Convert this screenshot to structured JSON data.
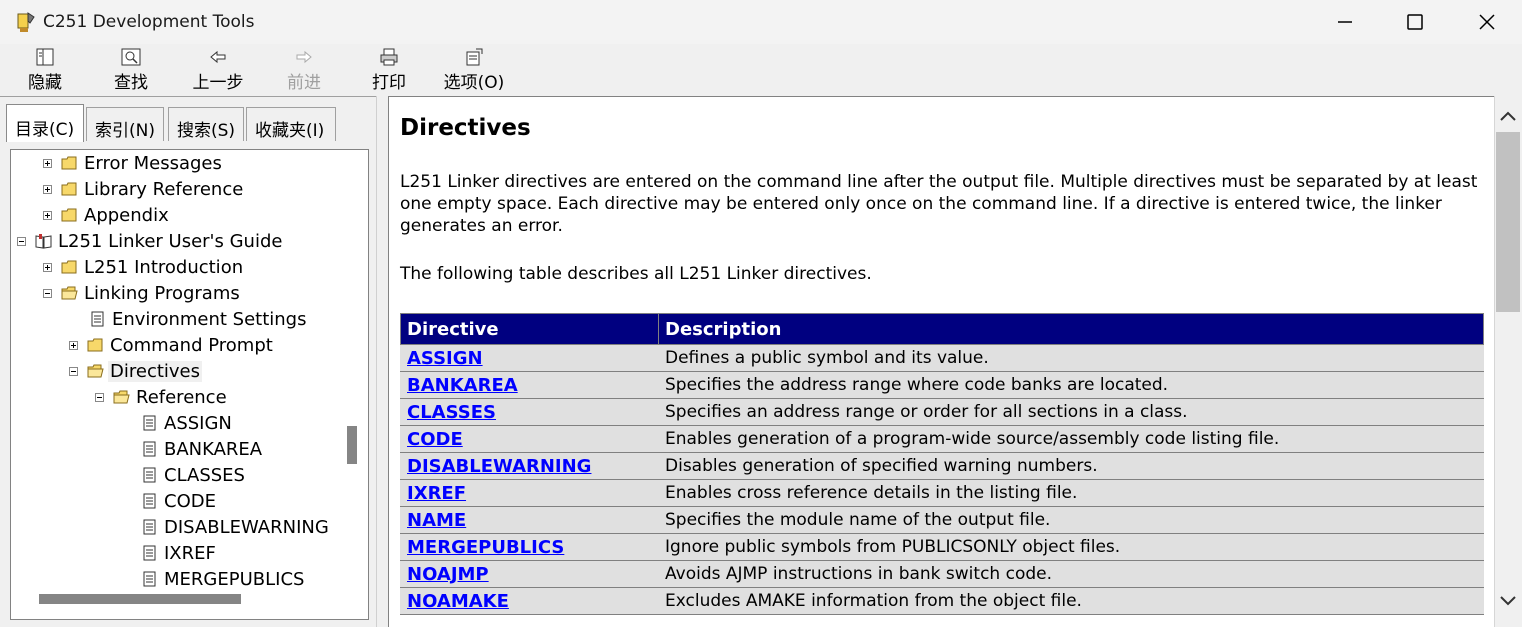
{
  "window": {
    "title": "C251 Development Tools"
  },
  "toolbar": {
    "buttons": [
      {
        "label": "隐藏",
        "icon": "hide-icon",
        "enabled": true
      },
      {
        "label": "查找",
        "icon": "find-icon",
        "enabled": true
      },
      {
        "label": "上一步",
        "icon": "back-icon",
        "enabled": true
      },
      {
        "label": "前进",
        "icon": "forward-icon",
        "enabled": false
      },
      {
        "label": "打印",
        "icon": "print-icon",
        "enabled": true
      },
      {
        "label": "选项(O)",
        "icon": "options-icon",
        "enabled": true
      }
    ]
  },
  "nav_tabs": [
    {
      "label": "目录(C)",
      "active": true
    },
    {
      "label": "索引(N)",
      "active": false
    },
    {
      "label": "搜索(S)",
      "active": false
    },
    {
      "label": "收藏夹(I)",
      "active": false
    }
  ],
  "tree": {
    "items": [
      {
        "label": "Error Messages",
        "type": "folder",
        "expander": "plus",
        "level": 1
      },
      {
        "label": "Library Reference",
        "type": "folder",
        "expander": "plus",
        "level": 1
      },
      {
        "label": "Appendix",
        "type": "folder",
        "expander": "plus",
        "level": 1
      },
      {
        "label": "L251 Linker User's Guide",
        "type": "book",
        "expander": "minus",
        "level": 0
      },
      {
        "label": "L251 Introduction",
        "type": "folder",
        "expander": "plus",
        "level": 1
      },
      {
        "label": "Linking Programs",
        "type": "folder-open",
        "expander": "minus",
        "level": 1
      },
      {
        "label": "Environment Settings",
        "type": "page",
        "expander": "none",
        "level": 2
      },
      {
        "label": "Command Prompt",
        "type": "folder",
        "expander": "plus",
        "level": 2
      },
      {
        "label": "Directives",
        "type": "folder-open",
        "expander": "minus",
        "level": 2,
        "selected": true
      },
      {
        "label": "Reference",
        "type": "folder-open",
        "expander": "minus",
        "level": 3
      },
      {
        "label": "ASSIGN",
        "type": "page",
        "expander": "none",
        "level": 4
      },
      {
        "label": "BANKAREA",
        "type": "page",
        "expander": "none",
        "level": 4
      },
      {
        "label": "CLASSES",
        "type": "page",
        "expander": "none",
        "level": 4
      },
      {
        "label": "CODE",
        "type": "page",
        "expander": "none",
        "level": 4
      },
      {
        "label": "DISABLEWARNING",
        "type": "page",
        "expander": "none",
        "level": 4
      },
      {
        "label": "IXREF",
        "type": "page",
        "expander": "none",
        "level": 4
      },
      {
        "label": "MERGEPUBLICS",
        "type": "page",
        "expander": "none",
        "level": 4
      }
    ]
  },
  "article": {
    "heading": "Directives",
    "para1": "L251 Linker directives are entered on the command line after the output file. Multiple directives must be separated by at least one empty space. Each directive may be entered only once on the command line. If a directive is entered twice, the linker generates an error.",
    "para2": "The following table describes all L251 Linker directives.",
    "table_headers": [
      "Directive",
      "Description"
    ],
    "table_rows": [
      {
        "directive": "ASSIGN",
        "description": "Defines a public symbol and its value."
      },
      {
        "directive": "BANKAREA",
        "description": "Specifies the address range where code banks are located."
      },
      {
        "directive": "CLASSES",
        "description": "Specifies an address range or order for all sections in a class."
      },
      {
        "directive": "CODE",
        "description": "Enables generation of a program-wide source/assembly code listing file."
      },
      {
        "directive": "DISABLEWARNING",
        "description": "Disables generation of specified warning numbers."
      },
      {
        "directive": "IXREF",
        "description": "Enables cross reference details in the listing file."
      },
      {
        "directive": "NAME",
        "description": "Specifies the module name of the output file."
      },
      {
        "directive": "MERGEPUBLICS",
        "description": "Ignore public symbols from PUBLICSONLY object files."
      },
      {
        "directive": "NOAJMP",
        "description": "Avoids AJMP instructions in bank switch code."
      },
      {
        "directive": "NOAMAKE",
        "description": "Excludes AMAKE information from the object file."
      }
    ]
  },
  "colors": {
    "table_header_bg": "#000080",
    "table_row_bg": "#e0e0e0",
    "link": "#0000ff"
  }
}
